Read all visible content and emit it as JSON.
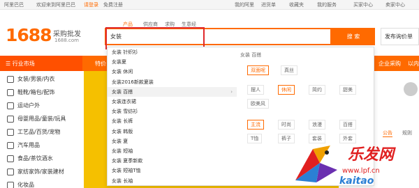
{
  "topbar": {
    "items": [
      "阿里巴巴",
      "欢迎来到阿里巴巴",
      "请登录",
      "免费注册",
      "我的阿里",
      "进货单",
      "收藏夹",
      "我的服务",
      "买家中心",
      "卖家中心"
    ]
  },
  "logo": {
    "text": "1688",
    "slogan": "采购批发",
    "url": "1688.com"
  },
  "search": {
    "tabs": [
      "产品",
      "供应商",
      "求购",
      "生意经"
    ],
    "query": "女装",
    "button": "搜 索",
    "post_label": "发布询价单"
  },
  "nav": {
    "category_label": "行业市场",
    "items": [
      "特价",
      "",
      "",
      "",
      "企业采购",
      "以内"
    ]
  },
  "sidebar": {
    "categories": [
      "女装/男装/内衣",
      "鞋靴/箱包/配饰",
      "运动户外",
      "母婴用品/童装/玩具",
      "工艺品/百货/宠物",
      "汽车用品",
      "食品/茶饮酒水",
      "家纺家饰/家装建材",
      "化妆品"
    ]
  },
  "dropdown": {
    "suggestions": [
      "女装 针织衫",
      "女装夏",
      "女装 休闲",
      "女装2016新款夏装",
      "女装 百搭",
      "女装连衣裙",
      "女装 雪纺衫",
      "女装 长裤",
      "女装 韩版",
      "女装 夏",
      "女装 短袖",
      "女装 夏季新款",
      "女装 短袖T恤",
      "女装 长袖"
    ],
    "attr_title": "女装 百搭",
    "chips_row1": [
      "双面呢",
      "真丝"
    ],
    "chips_row2": [
      "摆人",
      "休闲",
      "简约",
      "甜美"
    ],
    "chips_row3": [
      "欧美风"
    ],
    "chips_row4": [
      "主流",
      "时尚",
      "浪漫",
      "百搭"
    ],
    "chips_row5": [
      "T恤",
      "裤子",
      "套装",
      "外套"
    ]
  },
  "right_panel": {
    "tabs": [
      "公告",
      "规则"
    ]
  },
  "watermark": {
    "title": "乐发网",
    "url": "www.lpf.cn",
    "brand": "kaitao"
  },
  "colors": {
    "accent": "#ff6a00",
    "banner": "#f5c000",
    "annotation": "#e0292b"
  }
}
